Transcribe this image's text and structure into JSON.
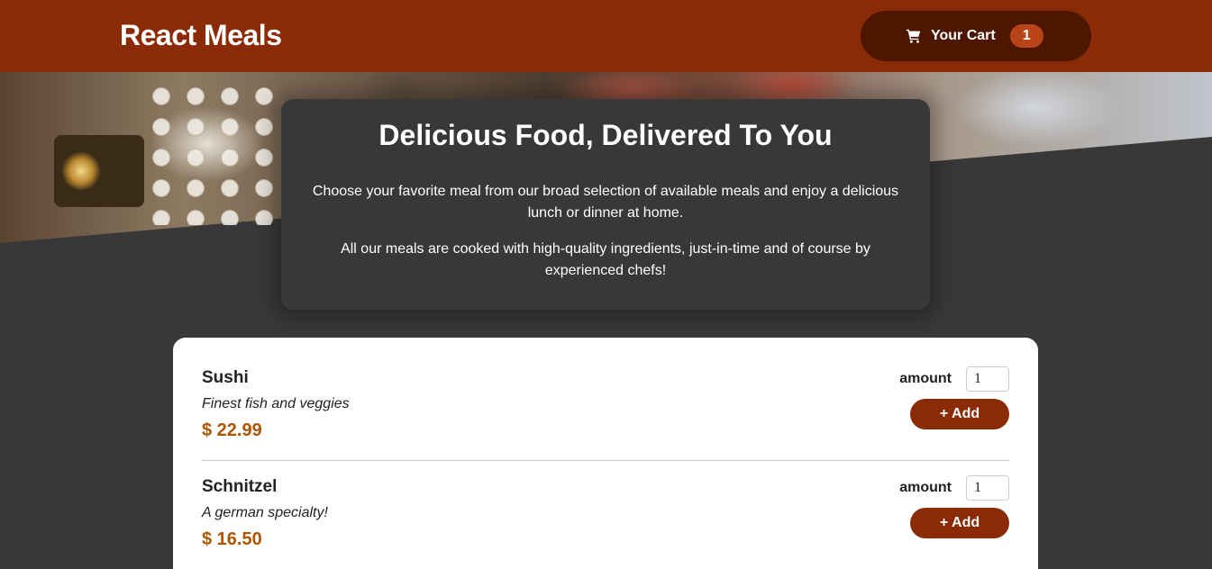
{
  "header": {
    "app_title": "React Meals",
    "cart": {
      "label": "Your Cart",
      "count": "1",
      "icon": "cart-icon"
    }
  },
  "hero": {
    "image": "buffet-table-photo"
  },
  "summary": {
    "title": "Delicious Food, Delivered To You",
    "paragraph1": "Choose your favorite meal from our broad selection of available meals and enjoy a delicious lunch or dinner at home.",
    "paragraph2": "All our meals are cooked with high-quality ingredients, just-in-time and of course by experienced chefs!"
  },
  "meals": [
    {
      "name": "Sushi",
      "description": "Finest fish and veggies",
      "price": "$ 22.99",
      "amount_label": "amount",
      "amount_value": "1",
      "add_label": "+ Add"
    },
    {
      "name": "Schnitzel",
      "description": "A german specialty!",
      "price": "$ 16.50",
      "amount_label": "amount",
      "amount_value": "1",
      "add_label": "+ Add"
    }
  ],
  "colors": {
    "header_bg": "#8a2b06",
    "cart_button_bg": "#4d1601",
    "cart_badge_bg": "#b94517",
    "page_bg": "#383838",
    "price": "#ad5502"
  }
}
